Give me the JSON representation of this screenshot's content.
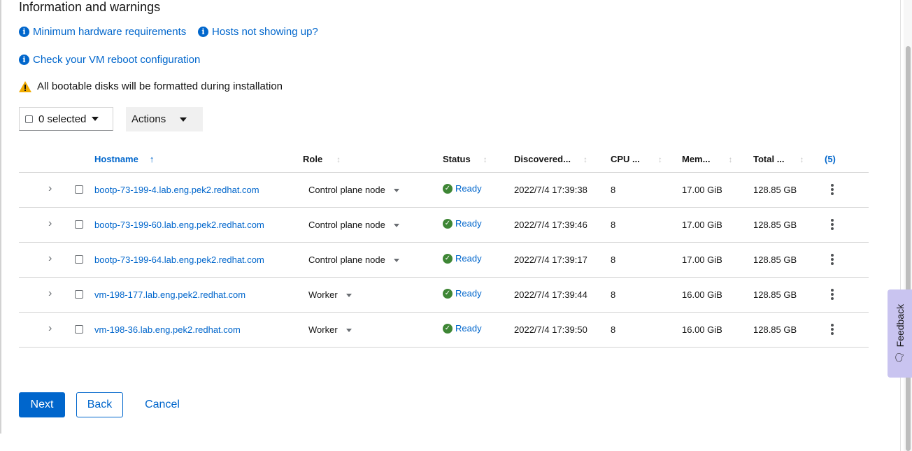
{
  "section_title": "Information and warnings",
  "info_links": {
    "hardware": "Minimum hardware requirements",
    "hosts_missing": "Hosts not showing up?",
    "vm_reboot": "Check your VM reboot configuration"
  },
  "warning_text": "All bootable disks will be formatted during installation",
  "toolbar": {
    "selected_label": "0 selected",
    "actions_label": "Actions"
  },
  "table": {
    "headers": {
      "hostname": "Hostname",
      "role": "Role",
      "status": "Status",
      "discovered": "Discovered...",
      "cpu": "CPU ...",
      "memory": "Mem...",
      "total": "Total ...",
      "count": "(5)"
    },
    "rows": [
      {
        "hostname": "bootp-73-199-4.lab.eng.pek2.redhat.com",
        "role": "Control plane node",
        "status": "Ready",
        "discovered": "2022/7/4 17:39:38",
        "cpu": "8",
        "memory": "17.00 GiB",
        "total": "128.85 GB"
      },
      {
        "hostname": "bootp-73-199-60.lab.eng.pek2.redhat.com",
        "role": "Control plane node",
        "status": "Ready",
        "discovered": "2022/7/4 17:39:46",
        "cpu": "8",
        "memory": "17.00 GiB",
        "total": "128.85 GB"
      },
      {
        "hostname": "bootp-73-199-64.lab.eng.pek2.redhat.com",
        "role": "Control plane node",
        "status": "Ready",
        "discovered": "2022/7/4 17:39:17",
        "cpu": "8",
        "memory": "17.00 GiB",
        "total": "128.85 GB"
      },
      {
        "hostname": "vm-198-177.lab.eng.pek2.redhat.com",
        "role": "Worker",
        "status": "Ready",
        "discovered": "2022/7/4 17:39:44",
        "cpu": "8",
        "memory": "16.00 GiB",
        "total": "128.85 GB"
      },
      {
        "hostname": "vm-198-36.lab.eng.pek2.redhat.com",
        "role": "Worker",
        "status": "Ready",
        "discovered": "2022/7/4 17:39:50",
        "cpu": "8",
        "memory": "16.00 GiB",
        "total": "128.85 GB"
      }
    ]
  },
  "footer": {
    "next_label": "Next",
    "back_label": "Back",
    "cancel_label": "Cancel"
  },
  "feedback_label": "Feedback",
  "colors": {
    "link": "#0066cc",
    "success": "#3e8635",
    "warning": "#f0ab00",
    "feedback_tab": "#c9c4f0"
  }
}
